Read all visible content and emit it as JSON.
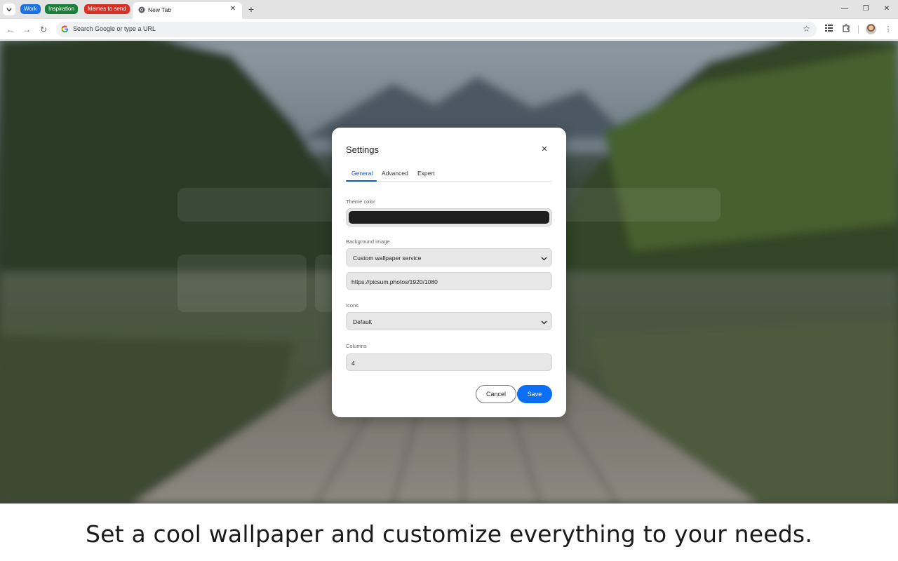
{
  "browser": {
    "tab_groups": [
      "Work",
      "Inspiration",
      "Memes to send"
    ],
    "active_tab_title": "New Tab",
    "omnibox_placeholder": "Search Google or type a URL"
  },
  "settings_dialog": {
    "title": "Settings",
    "tabs": [
      "General",
      "Advanced",
      "Expert"
    ],
    "active_tab": "General",
    "theme_color_label": "Theme color",
    "theme_color_value": "#1e1e1e",
    "background_image_label": "Background image",
    "background_image_selected": "Custom wallpaper service",
    "background_image_url": "https://picsum.photos/1920/1080",
    "icons_label": "Icons",
    "icons_selected": "Default",
    "columns_label": "Columns",
    "columns_value": "4",
    "cancel_label": "Cancel",
    "save_label": "Save"
  },
  "caption": "Set a cool wallpaper and customize everything to your needs.",
  "colors": {
    "accent": "#0b57d0",
    "save_button": "#0b6ef5",
    "tab_group_work": "#1a73e8",
    "tab_group_inspiration": "#188038",
    "tab_group_memes": "#d93025"
  }
}
